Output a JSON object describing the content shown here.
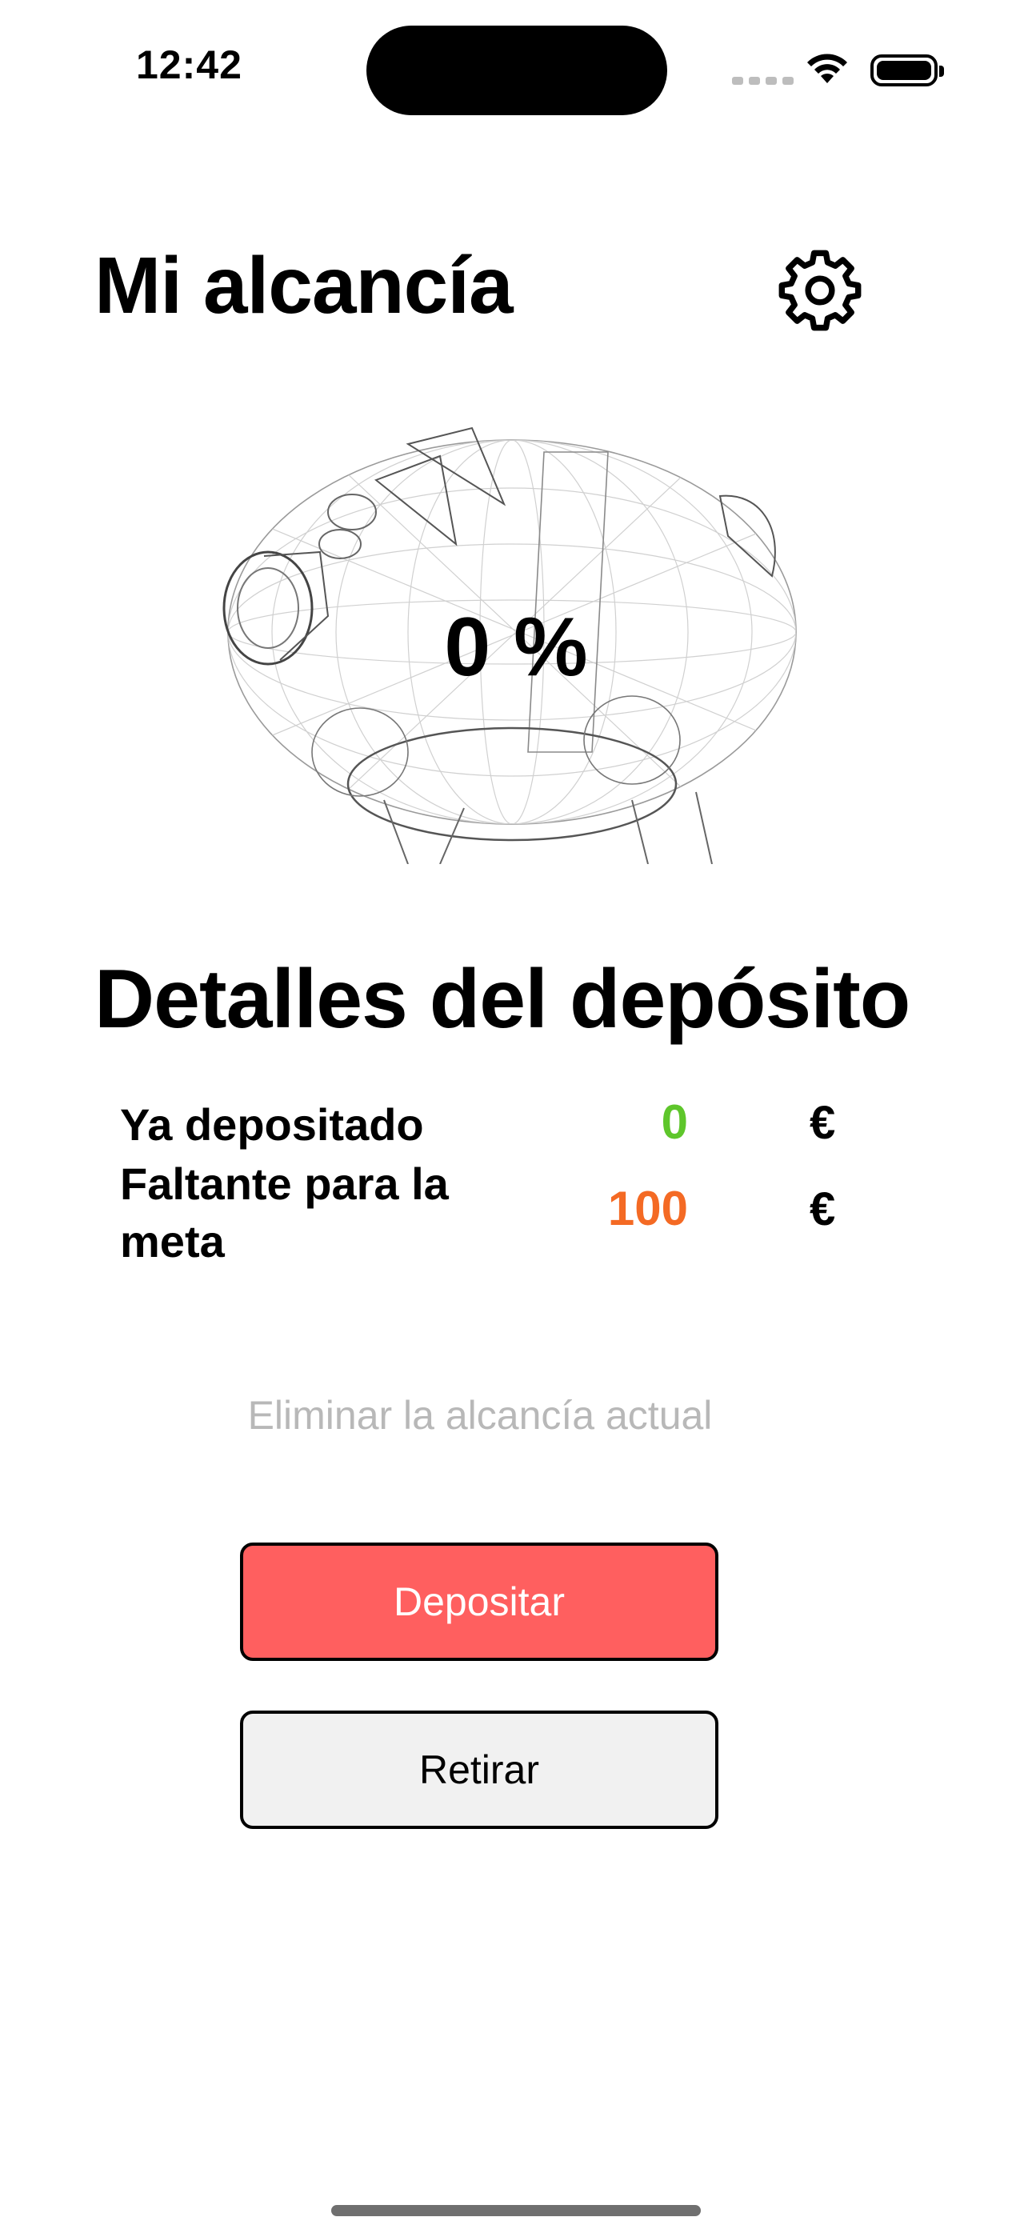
{
  "status_bar": {
    "time": "12:42",
    "icons": [
      "cellular-icon",
      "wifi-icon",
      "battery-icon"
    ]
  },
  "header": {
    "title": "Mi alcancía",
    "settings_icon": "gear-icon"
  },
  "piggy": {
    "illustration": "piggy-bank-wireframe",
    "progress_label": "0 %",
    "progress_fraction": 0
  },
  "details": {
    "title": "Detalles del depósito",
    "rows": [
      {
        "label": "Ya depositado",
        "value": "0",
        "currency": "€",
        "color": "#5ec62b"
      },
      {
        "label": "Faltante para la meta",
        "value": "100",
        "currency": "€",
        "color": "#f46a24"
      }
    ]
  },
  "actions": {
    "delete_label": "Eliminar la alcancía actual",
    "deposit_label": "Depositar",
    "withdraw_label": "Retirar",
    "deposit_color": "#ff5f5f"
  }
}
